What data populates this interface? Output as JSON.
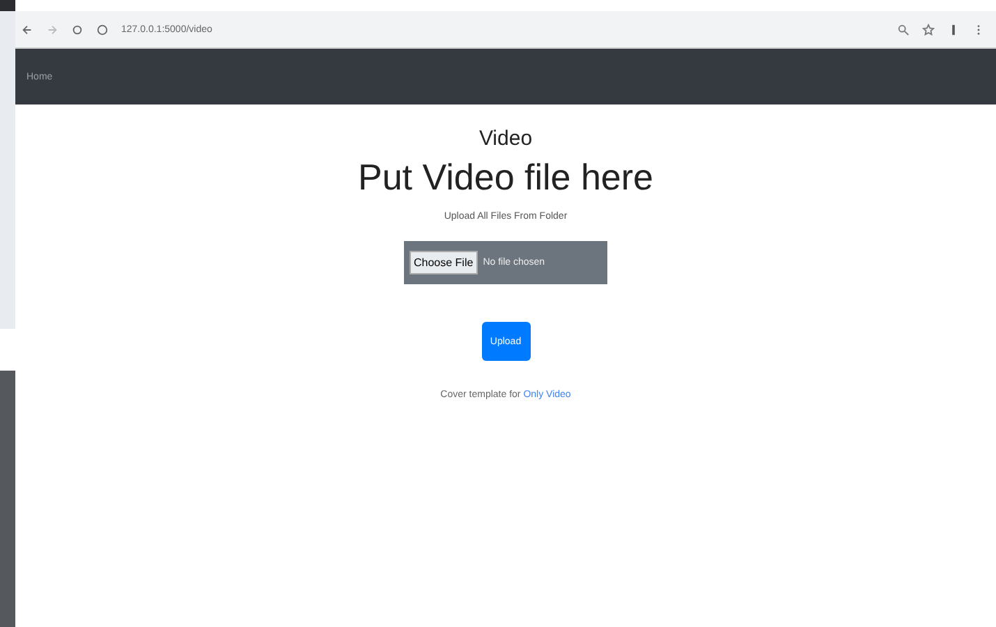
{
  "browser": {
    "url": "127.0.0.1:5000/video"
  },
  "navbar": {
    "brand": "Home"
  },
  "page": {
    "heading": "Video",
    "title": "Put Video file here",
    "subtitle": "Upload All Files From Folder",
    "file_input": {
      "button": "Choose File",
      "status": "No file chosen"
    },
    "upload_button": "Upload",
    "footer": {
      "text": "Cover template for ",
      "link": "Only Video"
    }
  }
}
